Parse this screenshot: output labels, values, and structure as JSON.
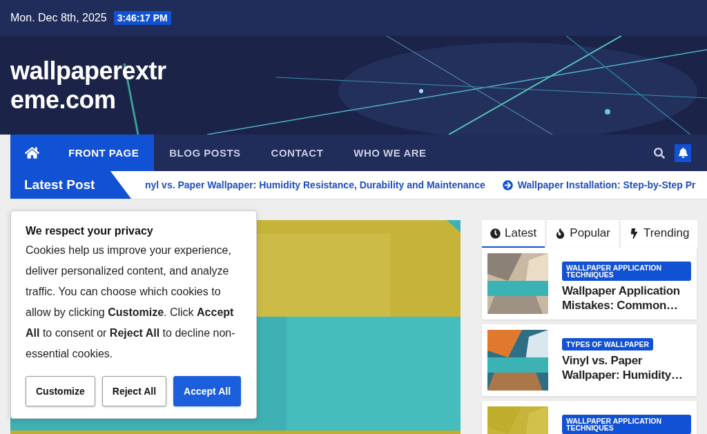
{
  "topbar": {
    "date": "Mon. Dec 8th, 2025",
    "time": "3:46:17 PM"
  },
  "header": {
    "site_title": "wallpaperextreme.com"
  },
  "nav": {
    "items": [
      {
        "kind": "home",
        "selected": true
      },
      {
        "kind": "link",
        "label": "FRONT PAGE",
        "selected": true
      },
      {
        "kind": "link",
        "label": "BLOG POSTS",
        "selected": false
      },
      {
        "kind": "link",
        "label": "CONTACT",
        "selected": false
      },
      {
        "kind": "link",
        "label": "WHO WE ARE",
        "selected": false
      }
    ]
  },
  "ticker": {
    "label": "Latest Post",
    "items": [
      {
        "title": "nyl vs. Paper Wallpaper: Humidity Resistance, Durability and Maintenance",
        "arrow": false
      },
      {
        "title": "Wallpaper Installation: Step-by-Step Pr",
        "arrow": true
      }
    ]
  },
  "sidebar": {
    "tabs": [
      {
        "kind": "clock",
        "label": "Latest",
        "selected": true
      },
      {
        "kind": "fire",
        "label": "Popular",
        "selected": false
      },
      {
        "kind": "bolt",
        "label": "Trending",
        "selected": false
      }
    ],
    "posts": [
      {
        "category": "WALLPAPER APPLICATION TECHNIQUES",
        "title": "Wallpaper Application Mistakes: Common…"
      },
      {
        "category": "TYPES OF WALLPAPER",
        "title": "Vinyl vs. Paper Wallpaper: Humidity…"
      },
      {
        "category": "WALLPAPER APPLICATION TECHNIQUES"
      }
    ]
  },
  "cookie": {
    "title": "We respect your privacy",
    "body": "Cookies help us improve your experience, deliver personalized content, and analyze traffic. You can choose which cookies to allow by clicking **Customize**. Click **Accept All** to consent or **Reject All** to decline non-essential cookies.",
    "buttons": [
      {
        "label": "Customize",
        "primary": false
      },
      {
        "label": "Reject All",
        "primary": false
      },
      {
        "label": "Accept All",
        "primary": true
      }
    ]
  }
}
